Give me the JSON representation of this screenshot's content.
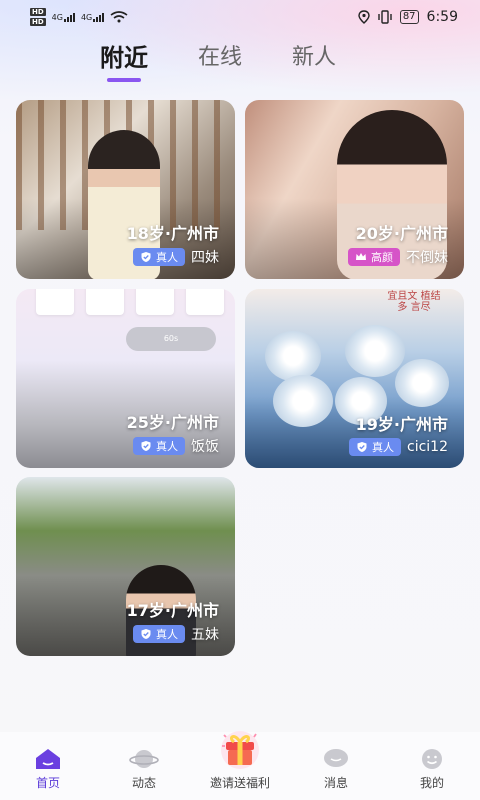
{
  "status_bar": {
    "hd_labels": [
      "HD",
      "HD"
    ],
    "signal_1": "4G",
    "signal_2": "4G",
    "battery": "87",
    "time": "6:59"
  },
  "tabs": [
    {
      "label": "附近",
      "active": true
    },
    {
      "label": "在线",
      "active": false
    },
    {
      "label": "新人",
      "active": false
    }
  ],
  "cards": [
    {
      "age_city": "18岁·广州市",
      "badge": "真人",
      "badge_type": "real",
      "name": "四妹"
    },
    {
      "age_city": "20岁·广州市",
      "badge": "高颜",
      "badge_type": "beauty",
      "name": "不倒妹"
    },
    {
      "age_city": "25岁·广州市",
      "badge": "真人",
      "badge_type": "real",
      "name": "饭饭",
      "pill": "60s"
    },
    {
      "age_city": "19岁·广州市",
      "badge": "真人",
      "badge_type": "real",
      "name": "cici12",
      "note": "宜且文 植结多 言尽"
    },
    {
      "age_city": "17岁·广州市",
      "badge": "真人",
      "badge_type": "real",
      "name": "五妹"
    }
  ],
  "bottom_nav": [
    {
      "label": "首页",
      "icon": "home-icon",
      "active": true
    },
    {
      "label": "动态",
      "icon": "planet-icon",
      "active": false
    },
    {
      "label": "邀请送福利",
      "icon": "gift-icon",
      "active": false
    },
    {
      "label": "消息",
      "icon": "chat-icon",
      "active": false
    },
    {
      "label": "我的",
      "icon": "profile-icon",
      "active": false
    }
  ],
  "colors": {
    "accent": "#8a56f0",
    "real_badge": "#6a8bf0",
    "beauty_badge": "#d654c8"
  }
}
